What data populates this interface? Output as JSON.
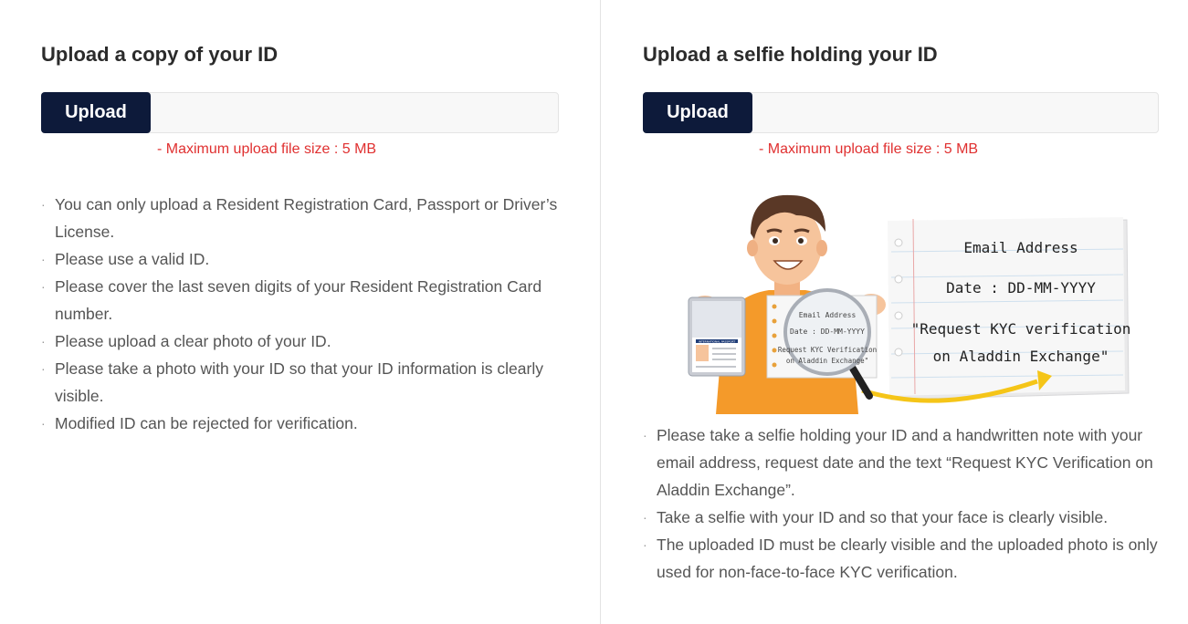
{
  "left_panel": {
    "title": "Upload a copy of your ID",
    "upload_label": "Upload",
    "size_note": "- Maximum upload file size : 5 MB",
    "notes": [
      "You can only upload a Resident Registration Card, Passport or Driver’s License.",
      "Please use a valid ID.",
      "Please cover the last seven digits of your Resident Registration Card number.",
      "Please upload a clear photo of your ID.",
      "Please take a photo with your ID so that your ID information is clearly visible.",
      "Modified ID can be rejected for verification."
    ]
  },
  "right_panel": {
    "title": "Upload a selfie holding your ID",
    "upload_label": "Upload",
    "size_note": "- Maximum upload file size : 5 MB",
    "illustration": {
      "note_line1": "Email Address",
      "note_line2": "Date : DD-MM-YYYY",
      "note_line3": "\"Request KYC verification",
      "note_line4": "on Aladdin Exchange\"",
      "small_line1": "Email Address",
      "small_line2": "Date : DD-MM-YYYY",
      "small_line3": "Request KYC Verification",
      "small_line4": "on Aladdin Exchange\"",
      "passport_label": "INTERNATIONAL PASSPORT"
    },
    "notes": [
      "Please take a selfie holding your ID and a handwritten note with your email address, request date and the text “Request KYC Verification on Aladdin Exchange”.",
      "Take a selfie with your ID and so that your face is clearly visible.",
      "The uploaded ID must be clearly visible and the uploaded photo is only used for non-face-to-face KYC verification."
    ]
  },
  "colors": {
    "button_bg": "#0d1a3a",
    "warning": "#e03030",
    "shirt": "#f49a2a",
    "arrow": "#f5c518"
  }
}
